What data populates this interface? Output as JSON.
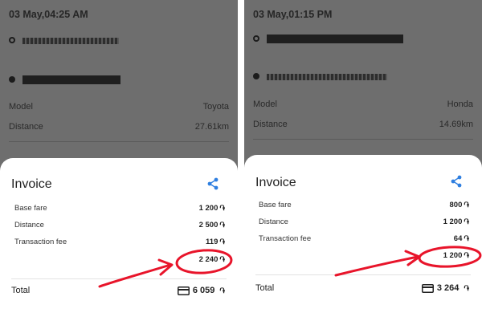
{
  "colors": {
    "annotation_red": "#e8142a",
    "share_blue": "#2f7fe0",
    "backdrop_gray": "#6e6e6e"
  },
  "left": {
    "datetime": "03 May,04:25 AM",
    "model_label": "Model",
    "model_value": "Toyota",
    "distance_label": "Distance",
    "distance_value": "27.61km",
    "invoice": {
      "title": "Invoice",
      "items": [
        {
          "label": "Base fare",
          "value": "1 200"
        },
        {
          "label": "Distance",
          "value": "2 500"
        },
        {
          "label": "Transaction fee",
          "value": "119"
        }
      ],
      "circled_value": "2 240",
      "total_label": "Total",
      "total_value": "6 059"
    }
  },
  "right": {
    "datetime": "03 May,01:15 PM",
    "model_label": "Model",
    "model_value": "Honda",
    "distance_label": "Distance",
    "distance_value": "14.69km",
    "invoice": {
      "title": "Invoice",
      "items": [
        {
          "label": "Base fare",
          "value": "800"
        },
        {
          "label": "Distance",
          "value": "1 200"
        },
        {
          "label": "Transaction fee",
          "value": "64"
        }
      ],
      "circled_value": "1 200",
      "total_label": "Total",
      "total_value": "3 264"
    }
  },
  "currency_symbol": "֏",
  "icons": [
    "share-icon",
    "card-icon",
    "route-start-icon",
    "route-end-icon"
  ]
}
